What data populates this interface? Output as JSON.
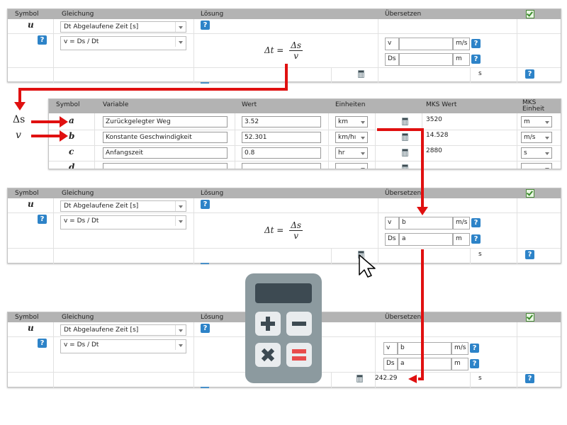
{
  "headers": {
    "symbol": "Symbol",
    "gleichung": "Gleichung",
    "loesung": "Lösung",
    "uebersetzen": "Übersetzen"
  },
  "panels": [
    {
      "symbol": "u",
      "equation_select": "Dt Abgelaufene Zeit [s]",
      "formula_select": "v = Ds / Dt",
      "translate": [
        {
          "label": "v",
          "value": "",
          "unit": "m/s"
        },
        {
          "label": "Ds",
          "value": "",
          "unit": "m"
        }
      ],
      "result_value": "",
      "result_unit": "s"
    },
    {
      "symbol": "u",
      "equation_select": "Dt Abgelaufene Zeit [s]",
      "formula_select": "v = Ds / Dt",
      "translate": [
        {
          "label": "v",
          "value": "b",
          "unit": "m/s"
        },
        {
          "label": "Ds",
          "value": "a",
          "unit": "m"
        }
      ],
      "result_value": "",
      "result_unit": "s"
    },
    {
      "symbol": "u",
      "equation_select": "Dt Abgelaufene Zeit [s]",
      "formula_select": "v = Ds / Dt",
      "translate": [
        {
          "label": "v",
          "value": "b",
          "unit": "m/s"
        },
        {
          "label": "Ds",
          "value": "a",
          "unit": "m"
        }
      ],
      "result_value": "242.29",
      "result_unit": "s"
    }
  ],
  "formula": {
    "lhs": "Δt =",
    "num": "Δs",
    "den": "v"
  },
  "variables": {
    "headers": {
      "symbol": "Symbol",
      "variable": "Variable",
      "wert": "Wert",
      "einheiten": "Einheiten",
      "mks_wert": "MKS Wert",
      "mks_einheit": "MKS Einheit"
    },
    "outside_labels": [
      "Δs",
      "v"
    ],
    "rows": [
      {
        "symbol": "a",
        "name": "Zurückgelegter Weg",
        "value": "3.52",
        "unit": "km",
        "mks_value": "3520",
        "mks_unit": "m"
      },
      {
        "symbol": "b",
        "name": "Konstante Geschwindigkeit",
        "value": "52.301",
        "unit": "km/hı",
        "mks_value": "14.528",
        "mks_unit": "m/s"
      },
      {
        "symbol": "c",
        "name": "Anfangszeit",
        "value": "0.8",
        "unit": "hr",
        "mks_value": "2880",
        "mks_unit": "s"
      },
      {
        "symbol": "d",
        "name": "",
        "value": "",
        "unit": "",
        "mks_value": "",
        "mks_unit": ""
      }
    ]
  },
  "help_glyph": "?",
  "icons": {
    "help": "help-icon",
    "checkbox": "checkbox-checked-icon",
    "calculator": "calculator-icon",
    "cursor": "mouse-pointer-icon"
  },
  "colors": {
    "arrow": "#e01010",
    "header": "#b3b3b3",
    "help": "#2d83c8",
    "calc_body": "#8c9a9f",
    "calc_screen": "#3d4a52",
    "calc_red": "#e84b4b"
  }
}
